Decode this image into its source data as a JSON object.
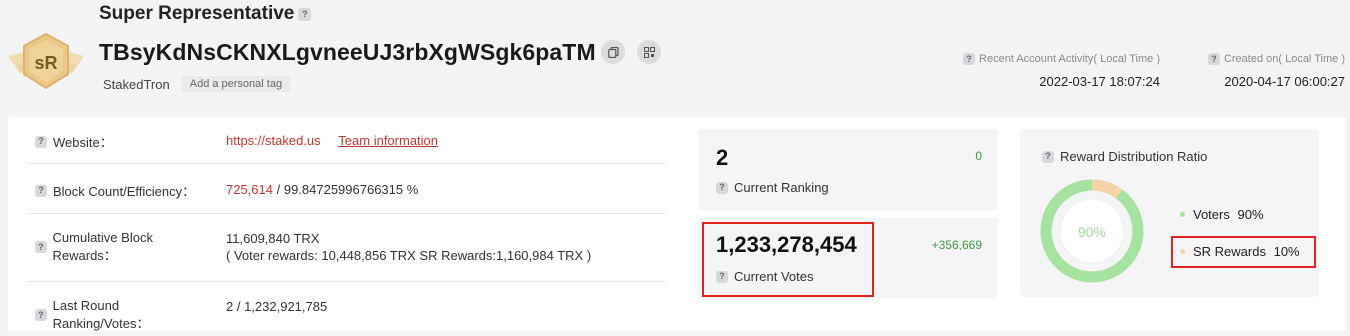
{
  "header": {
    "title": "Super Representative",
    "address": "TBsyKdNsCKNXLgvneeUJ3rbXgWSgk6paTM",
    "badge_text": "sR",
    "name": "StakedTron",
    "add_tag_label": "Add a personal tag",
    "recent_activity_label": "Recent Account Activity( Local Time )",
    "recent_activity_value": "2022-03-17 18:07:24",
    "created_label": "Created on( Local Time )",
    "created_value": "2020-04-17 06:00:27"
  },
  "info": {
    "website_label": "Website：",
    "website_url": "https://staked.us",
    "team_link": "Team information",
    "block_label": "Block Count/Efficiency：",
    "block_count": "725,614",
    "block_efficiency": " / 99.84725996766315 %",
    "cumulative_label": "Cumulative Block Rewards：",
    "cumulative_value": "11,609,840 TRX",
    "cumulative_detail": "( Voter rewards: 10,448,856 TRX SR Rewards:1,160,984 TRX )",
    "last_round_label": "Last Round Ranking/Votes：",
    "last_round_value": "2 / 1,232,921,785"
  },
  "ranking": {
    "value": "2",
    "change": "0",
    "label": "Current Ranking"
  },
  "votes": {
    "value": "1,233,278,454",
    "change": "+356,669",
    "label": "Current Votes"
  },
  "reward_ratio": {
    "title": "Reward Distribution Ratio",
    "center_label": "90%",
    "voters_percent": 90,
    "sr_percent": 10,
    "voters_label": "Voters",
    "voters_value": "90%",
    "sr_label": "SR Rewards",
    "sr_value": "10%",
    "voters_color": "#a6e3a1",
    "sr_color": "#f6d2a8"
  },
  "colors": {
    "accent_red": "#c23631",
    "highlight_red": "#e0241c",
    "green": "#3c9a3c",
    "badge_gold": "#e9c889"
  }
}
